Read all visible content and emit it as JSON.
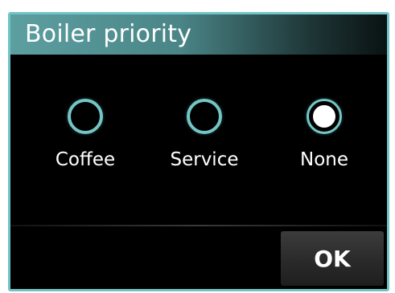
{
  "dialog": {
    "title": "Boiler priority",
    "options": [
      {
        "label": "Coffee",
        "selected": false
      },
      {
        "label": "Service",
        "selected": false
      },
      {
        "label": "None",
        "selected": true
      }
    ],
    "ok_label": "OK"
  },
  "colors": {
    "accent": "#74c6c6",
    "background": "#000000",
    "text": "#ffffff"
  }
}
